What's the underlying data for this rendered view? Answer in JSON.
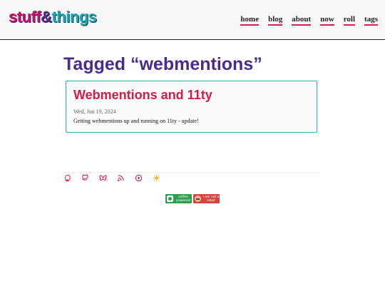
{
  "header": {
    "logo": {
      "part1": "stuff",
      "part2": "&",
      "part3": "things"
    },
    "nav": [
      "home",
      "blog",
      "about",
      "now",
      "roll",
      "tags"
    ]
  },
  "main": {
    "title": "Tagged “webmentions”",
    "posts": [
      {
        "title": "Webmentions and 11ty",
        "date": "Wed, Jun 19, 2024",
        "description": "Getting webmentions up and running on 11ty - update!"
      }
    ]
  },
  "footer": {
    "icons": [
      "mastodon-icon",
      "github-icon",
      "bluesky-icon",
      "rss-icon",
      "plus-circle-icon",
      "sun-icon"
    ],
    "icon_color": "#d81b46",
    "sun_color": "#f5b800",
    "badges": [
      {
        "text": "coffee powered",
        "color": "#2e9e4e"
      },
      {
        "text": "i am not a robot",
        "color": "#d4453e"
      }
    ]
  }
}
